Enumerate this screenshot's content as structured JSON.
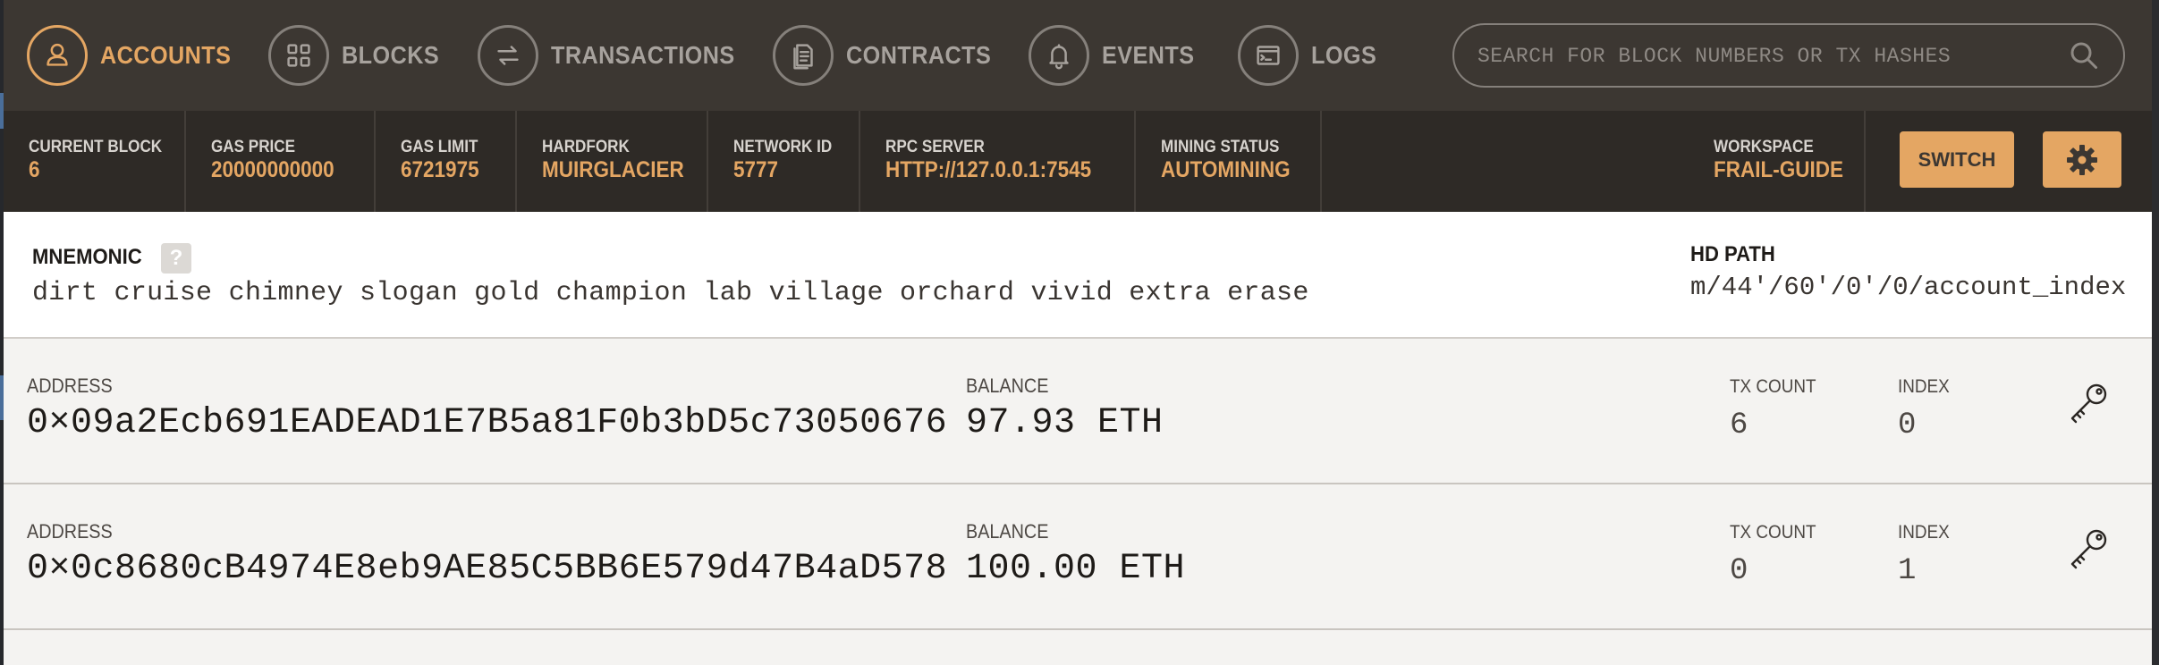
{
  "nav": {
    "items": [
      {
        "label": "ACCOUNTS",
        "icon": "user-icon",
        "active": true
      },
      {
        "label": "BLOCKS",
        "icon": "grid-icon"
      },
      {
        "label": "TRANSACTIONS",
        "icon": "swap-arrows-icon"
      },
      {
        "label": "CONTRACTS",
        "icon": "document-icon"
      },
      {
        "label": "EVENTS",
        "icon": "bell-icon"
      },
      {
        "label": "LOGS",
        "icon": "terminal-icon"
      }
    ],
    "search_placeholder": "SEARCH FOR BLOCK NUMBERS OR TX HASHES"
  },
  "status": {
    "current_block": {
      "label": "CURRENT BLOCK",
      "value": "6"
    },
    "gas_price": {
      "label": "GAS PRICE",
      "value": "20000000000"
    },
    "gas_limit": {
      "label": "GAS LIMIT",
      "value": "6721975"
    },
    "hardfork": {
      "label": "HARDFORK",
      "value": "MUIRGLACIER"
    },
    "network_id": {
      "label": "NETWORK ID",
      "value": "5777"
    },
    "rpc_server": {
      "label": "RPC SERVER",
      "value": "HTTP://127.0.0.1:7545"
    },
    "mining_status": {
      "label": "MINING STATUS",
      "value": "AUTOMINING"
    },
    "workspace": {
      "label": "WORKSPACE",
      "value": "FRAIL-GUIDE"
    },
    "switch_label": "SWITCH"
  },
  "mnemonic": {
    "label": "MNEMONIC",
    "help": "?",
    "words": "dirt cruise chimney slogan gold champion lab village orchard vivid extra erase",
    "hd_path_label": "HD PATH",
    "hd_path": "m/44'/60'/0'/0/account_index"
  },
  "accounts": {
    "labels": {
      "address": "ADDRESS",
      "balance": "BALANCE",
      "tx_count": "TX COUNT",
      "index": "INDEX"
    },
    "rows": [
      {
        "address": "0×09a2Ecb691EADEAD1E7B5a81F0b3bD5c73050676",
        "balance": "97.93 ETH",
        "tx_count": "6",
        "index": "0"
      },
      {
        "address": "0×0c8680cB4974E8eb9AE85C5BB6E579d47B4aD578",
        "balance": "100.00 ETH",
        "tx_count": "0",
        "index": "1"
      }
    ]
  },
  "colors": {
    "accent": "#e4a663",
    "nav_bg": "#3c3732",
    "status_bg": "#2e2a26"
  }
}
